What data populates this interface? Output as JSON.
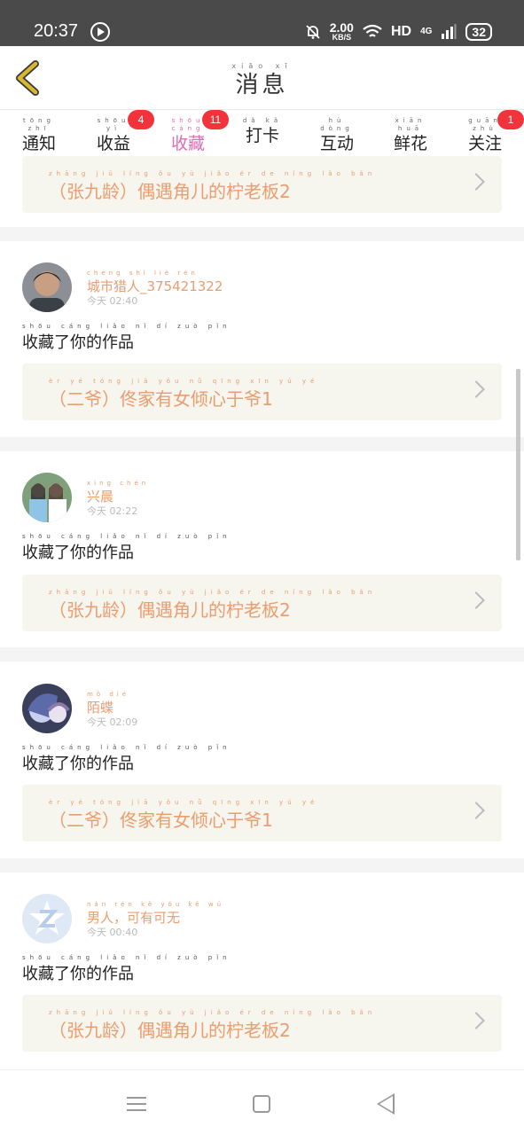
{
  "status_bar": {
    "time": "20:37",
    "speed_value": "2.00",
    "speed_unit": "KB/S",
    "hd": "HD",
    "network": "4G",
    "battery": "32"
  },
  "header": {
    "title": "消息",
    "title_pinyin": "xiāo xī"
  },
  "tabs": [
    {
      "label": "通知",
      "pinyin": "tōng zhī",
      "badge": ""
    },
    {
      "label": "收益",
      "pinyin": "shōu yì",
      "badge": "4"
    },
    {
      "label": "收藏",
      "pinyin": "shōu cáng",
      "badge": "11",
      "active": true
    },
    {
      "label": "打卡",
      "pinyin": "dǎ kǎ",
      "badge": ""
    },
    {
      "label": "互动",
      "pinyin": "hù dòng",
      "badge": ""
    },
    {
      "label": "鲜花",
      "pinyin": "xiān huā",
      "badge": ""
    },
    {
      "label": "关注",
      "pinyin": "guān zhù",
      "badge": "1"
    }
  ],
  "top_work": {
    "title": "（张九龄）偶遇角儿的柠老板2",
    "pinyin": "zhāng jiǔ líng ǒu yù jiǎo ér de níng lǎo bǎn"
  },
  "items": [
    {
      "username": "城市猎人_375421322",
      "username_pinyin": "chéng shì liè rén",
      "day": "今天",
      "time": "02:40",
      "action": "收藏了你的作品",
      "action_pinyin": "shōu cáng liǎo nǐ dí zuò pǐn",
      "work": "（二爷）佟家有女倾心于爷1",
      "work_pinyin": "èr yé tóng jiā yǒu nǚ qīng xīn yú yé"
    },
    {
      "username": "兴晨",
      "username_pinyin": "xìng chén",
      "day": "今天",
      "time": "02:22",
      "action": "收藏了你的作品",
      "action_pinyin": "shōu cáng liǎo nǐ dí zuò pǐn",
      "work": "（张九龄）偶遇角儿的柠老板2",
      "work_pinyin": "zhāng jiǔ líng ǒu yù jiǎo ér de níng lǎo bǎn"
    },
    {
      "username": "陌蝶",
      "username_pinyin": "mò dié",
      "day": "今天",
      "time": "02:09",
      "action": "收藏了你的作品",
      "action_pinyin": "shōu cáng liǎo nǐ dí zuò pǐn",
      "work": "（二爷）佟家有女倾心于爷1",
      "work_pinyin": "èr yé tóng jiā yǒu nǚ qīng xīn yú yé"
    },
    {
      "username": "男人，可有可无",
      "username_pinyin": "nán rén kě yǒu kě wú",
      "day": "今天",
      "time": "00:40",
      "action": "收藏了你的作品",
      "action_pinyin": "shōu cáng liǎo nǐ dí zuò pǐn",
      "work": "（张九龄）偶遇角儿的柠老板2",
      "work_pinyin": "zhāng jiǔ líng ǒu yù jiǎo ér de níng lǎo bǎn"
    }
  ],
  "icons": {
    "back": "chevron-left-icon",
    "card_arrow": "chevron-right-icon",
    "nav_menu": "menu-icon",
    "nav_home": "home-square-icon",
    "nav_back": "triangle-back-icon"
  },
  "colors": {
    "accent": "#e06bb2",
    "badge": "#f2333c",
    "orange_text": "#ea9d6f",
    "card_bg": "#f6f5ee",
    "back_arrow": "#d9b830"
  }
}
